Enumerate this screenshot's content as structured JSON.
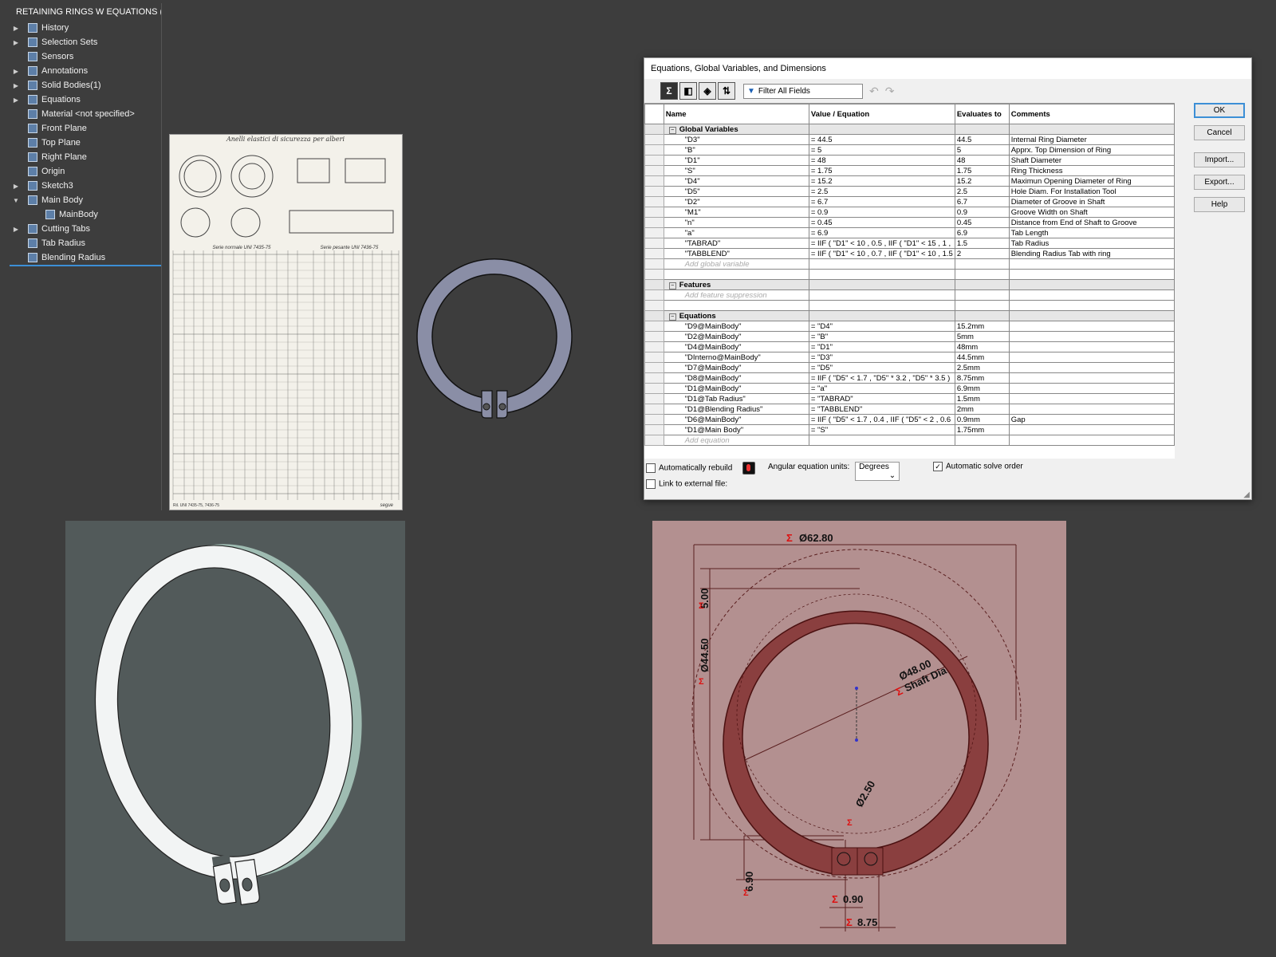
{
  "tree": {
    "title": "RETAINING RINGS W EQUATIONS  (De",
    "items": [
      {
        "label": "History",
        "arrow": "▶",
        "icon": "history-icon"
      },
      {
        "label": "Selection Sets",
        "arrow": "▶",
        "icon": "selection-sets-icon"
      },
      {
        "label": "Sensors",
        "arrow": "",
        "icon": "sensor-icon"
      },
      {
        "label": "Annotations",
        "arrow": "▶",
        "icon": "annotation-icon"
      },
      {
        "label": "Solid Bodies(1)",
        "arrow": "▶",
        "icon": "solid-bodies-icon"
      },
      {
        "label": "Equations",
        "arrow": "▶",
        "icon": "equations-icon"
      },
      {
        "label": "Material <not specified>",
        "arrow": "",
        "icon": "material-icon"
      },
      {
        "label": "Front Plane",
        "arrow": "",
        "icon": "plane-icon"
      },
      {
        "label": "Top Plane",
        "arrow": "",
        "icon": "plane-icon"
      },
      {
        "label": "Right Plane",
        "arrow": "",
        "icon": "plane-icon"
      },
      {
        "label": "Origin",
        "arrow": "",
        "icon": "origin-icon"
      },
      {
        "label": "Sketch3",
        "arrow": "▶",
        "icon": "sketch-icon"
      },
      {
        "label": "Main Body",
        "arrow": "▼",
        "icon": "extrude-icon"
      },
      {
        "label": "MainBody",
        "arrow": "",
        "icon": "sketch-icon"
      },
      {
        "label": "Cutting Tabs",
        "arrow": "▶",
        "icon": "cut-icon"
      },
      {
        "label": "Tab Radius",
        "arrow": "",
        "icon": "fillet-icon"
      },
      {
        "label": "Blending Radius",
        "arrow": "",
        "icon": "fillet-icon"
      }
    ]
  },
  "scan": {
    "title": "Anelli elastici di sicurezza per alberi",
    "serie_normale": "Serie normale UNI 7435-75",
    "serie_pesante": "Serie pesante UNI 7436-75",
    "footer_left": "Ril. UNI 7435-75, 7436-75",
    "footer_right": "segue"
  },
  "dialog": {
    "title": "Equations, Global Variables, and Dimensions",
    "filter_placeholder": "Filter All Fields",
    "columns": [
      "Name",
      "Value / Equation",
      "Evaluates to",
      "Comments"
    ],
    "sections": {
      "global": "Global Variables",
      "features": "Features",
      "equations": "Equations"
    },
    "add_global": "Add global variable",
    "add_feature": "Add feature suppression",
    "add_equation": "Add equation",
    "globals": [
      {
        "name": "\"D3\"",
        "value": "= 44.5",
        "eval": "44.5",
        "comment": "Internal Ring Diameter"
      },
      {
        "name": "\"B\"",
        "value": "= 5",
        "eval": "5",
        "comment": "Apprx. Top Dimension of Ring"
      },
      {
        "name": "\"D1\"",
        "value": "= 48",
        "eval": "48",
        "comment": "Shaft Diameter"
      },
      {
        "name": "\"S\"",
        "value": "= 1.75",
        "eval": "1.75",
        "comment": "Ring Thickness"
      },
      {
        "name": "\"D4\"",
        "value": "= 15.2",
        "eval": "15.2",
        "comment": "Maximun Opening Diameter of Ring"
      },
      {
        "name": "\"D5\"",
        "value": "= 2.5",
        "eval": "2.5",
        "comment": "Hole Diam. For Installation Tool"
      },
      {
        "name": "\"D2\"",
        "value": "= 6.7",
        "eval": "6.7",
        "comment": "Diameter of Groove in Shaft"
      },
      {
        "name": "\"M1\"",
        "value": "= 0.9",
        "eval": "0.9",
        "comment": "Groove Width on Shaft"
      },
      {
        "name": "\"n\"",
        "value": "= 0.45",
        "eval": "0.45",
        "comment": "Distance from End of Shaft to Groove"
      },
      {
        "name": "\"a\"",
        "value": "= 6.9",
        "eval": "6.9",
        "comment": "Tab Length"
      },
      {
        "name": "\"TABRAD\"",
        "value": "= IIF ( \"D1\" < 10 , 0.5 , IIF ( \"D1\" < 15 , 1 ,",
        "eval": "1.5",
        "comment": "Tab Radius"
      },
      {
        "name": "\"TABBLEND\"",
        "value": "= IIF ( \"D1\" < 10 , 0.7 , IIF ( \"D1\" < 10 , 1.5",
        "eval": "2",
        "comment": "Blending Radius Tab with ring"
      }
    ],
    "equations": [
      {
        "name": "\"D9@MainBody\"",
        "value": "= \"D4\"",
        "eval": "15.2mm",
        "comment": ""
      },
      {
        "name": "\"D2@MainBody\"",
        "value": "= \"B\"",
        "eval": "5mm",
        "comment": ""
      },
      {
        "name": "\"D4@MainBody\"",
        "value": "= \"D1\"",
        "eval": "48mm",
        "comment": ""
      },
      {
        "name": "\"DInterno@MainBody\"",
        "value": "= \"D3\"",
        "eval": "44.5mm",
        "comment": ""
      },
      {
        "name": "\"D7@MainBody\"",
        "value": "= \"D5\"",
        "eval": "2.5mm",
        "comment": ""
      },
      {
        "name": "\"D8@MainBody\"",
        "value": "= IIF ( \"D5\" < 1.7 , \"D5\" * 3.2 , \"D5\" * 3.5 )",
        "eval": "8.75mm",
        "comment": ""
      },
      {
        "name": "\"D1@MainBody\"",
        "value": "= \"a\"",
        "eval": "6.9mm",
        "comment": ""
      },
      {
        "name": "\"D1@Tab Radius\"",
        "value": "= \"TABRAD\"",
        "eval": "1.5mm",
        "comment": ""
      },
      {
        "name": "\"D1@Blending Radius\"",
        "value": "= \"TABBLEND\"",
        "eval": "2mm",
        "comment": ""
      },
      {
        "name": "\"D6@MainBody\"",
        "value": "= IIF ( \"D5\" < 1.7 , 0.4 , IIF ( \"D5\" < 2 , 0.6",
        "eval": "0.9mm",
        "comment": "Gap"
      },
      {
        "name": "\"D1@Main Body\"",
        "value": "= \"S\"",
        "eval": "1.75mm",
        "comment": ""
      }
    ],
    "buttons": [
      "OK",
      "Cancel",
      "Import...",
      "Export...",
      "Help"
    ],
    "auto_rebuild": "Automatically rebuild",
    "angular_label": "Angular equation units:",
    "angular_value": "Degrees",
    "auto_solve": "Automatic solve order",
    "link_external": "Link to external file:"
  },
  "sketch": {
    "dim_outer": "Ø62.80",
    "dim_top": "5.00",
    "dim_inner": "Ø44.50",
    "dim_shaft": "Ø48.00",
    "dim_shaft_label": "Shaft Dia",
    "dim_hole": "Ø2.50",
    "dim_tab": "6.90",
    "dim_gap": "0.90",
    "dim_width": "8.75",
    "sigma": "Σ"
  }
}
